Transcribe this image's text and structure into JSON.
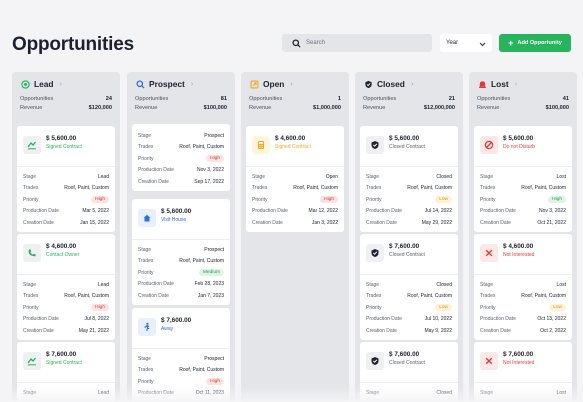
{
  "page": {
    "title": "Opportunities"
  },
  "search": {
    "placeholder": "Search"
  },
  "year_select": {
    "value": "Year"
  },
  "add_button": {
    "label": "Add Opportunity"
  },
  "labels": {
    "stage": "Stage",
    "trades": "Trades",
    "priority": "Priority",
    "production_date": "Production Date",
    "creation_date": "Creation Date",
    "opportunities": "Opportunities",
    "revenue": "Revenue"
  },
  "colors": {
    "lead": "#27b45c",
    "prospect": "#2f6fe4",
    "open": "#f2a81d",
    "closed": "#1f2430",
    "lost": "#e03b3b",
    "accent": "#27b45c"
  },
  "columns": [
    {
      "key": "lead",
      "name": "Lead",
      "icon": "lead-target-icon",
      "opportunities": "24",
      "revenue": "$120,000",
      "cards": [
        {
          "amount": "$ 5,600.00",
          "subtitle": "Signed Contract",
          "icon": "signature-icon",
          "stage": "Lead",
          "trades": "Roof, Paint, Custom",
          "priority": "High",
          "production_date": "Mar 5, 2022",
          "creation_date": "Jan 15, 2022"
        },
        {
          "amount": "$ 4,600.00",
          "subtitle": "Contact Owner",
          "icon": "phone-icon",
          "stage": "Lead",
          "trades": "Roof, Paint, Custom",
          "priority": "High",
          "production_date": "Jul 8, 2022",
          "creation_date": "May 21, 2022"
        },
        {
          "amount": "$ 7,600.00",
          "subtitle": "Signed Contract",
          "icon": "signature-icon",
          "stage": "Lead"
        }
      ]
    },
    {
      "key": "prospect",
      "name": "Prospect",
      "icon": "prospect-search-icon",
      "opportunities": "81",
      "revenue": "$100,000",
      "cards": [
        {
          "stage": "Prospect",
          "trades": "Roof, Paint, Custom",
          "priority": "High",
          "production_date": "Nov 3, 2022",
          "creation_date": "Sep 17, 2022"
        },
        {
          "amount": "$ 5,600.00",
          "subtitle": "Visit House",
          "icon": "house-icon",
          "stage": "Prospect",
          "trades": "Roof, Paint, Custom",
          "priority": "Medium",
          "production_date": "Feb 28, 2023",
          "creation_date": "Jan 7, 2023"
        },
        {
          "amount": "$ 7,600.00",
          "subtitle": "Away",
          "icon": "person-walking-icon",
          "stage": "Prospect",
          "trades": "Roof, Paint, Custom",
          "priority": "High",
          "production_date": "Oct 11, 2023"
        }
      ]
    },
    {
      "key": "open",
      "name": "Open",
      "icon": "open-folder-icon",
      "opportunities": "1",
      "revenue": "$1,000,000",
      "cards": [
        {
          "amount": "$ 4,600.00",
          "subtitle": "Signed Contract",
          "icon": "calculator-icon",
          "stage": "Open",
          "trades": "Roof, Paint, Custom",
          "priority": "High",
          "production_date": "Mar 12, 2022",
          "creation_date": "Jan 3, 2022"
        }
      ]
    },
    {
      "key": "closed",
      "name": "Closed",
      "icon": "shield-closed-icon",
      "opportunities": "21",
      "revenue": "$12,000,000",
      "cards": [
        {
          "amount": "$ 5,600.00",
          "subtitle": "Closed Contract",
          "icon": "shield-closed-icon",
          "stage": "Closed",
          "trades": "Roof, Paint, Custom",
          "priority": "Low",
          "production_date": "Jul 14, 2022",
          "creation_date": "May 29, 2022"
        },
        {
          "amount": "$ 7,600.00",
          "subtitle": "Closed Contract",
          "icon": "shield-closed-icon",
          "stage": "Closed",
          "trades": "Roof, Paint, Custom",
          "priority": "Low",
          "production_date": "Jul 10, 2022",
          "creation_date": "May 9, 2022"
        },
        {
          "amount": "$ 7,600.00",
          "subtitle": "Closed Contract",
          "icon": "shield-closed-icon",
          "stage": "Closed"
        }
      ]
    },
    {
      "key": "lost",
      "name": "Lost",
      "icon": "lost-alert-icon",
      "opportunities": "41",
      "revenue": "$100,000",
      "cards": [
        {
          "amount": "$ 5,600.00",
          "subtitle": "Do not Disturb",
          "icon": "do-not-disturb-icon",
          "stage": "Lost",
          "trades": "Roof, Paint, Custom",
          "priority": "High",
          "production_date": "Nov 3, 2022",
          "creation_date": "Oct 21, 2022"
        },
        {
          "amount": "$ 4,600.00",
          "subtitle": "Not Interested",
          "icon": "x-mark-icon",
          "stage": "Lost",
          "trades": "Roof, Paint, Custom",
          "priority": "Low",
          "production_date": "Oct 13, 2022",
          "creation_date": "Oct 2, 2022"
        },
        {
          "amount": "$ 7,600.00",
          "subtitle": "Not Interested",
          "icon": "x-mark-icon",
          "stage": "Lost"
        }
      ]
    }
  ]
}
